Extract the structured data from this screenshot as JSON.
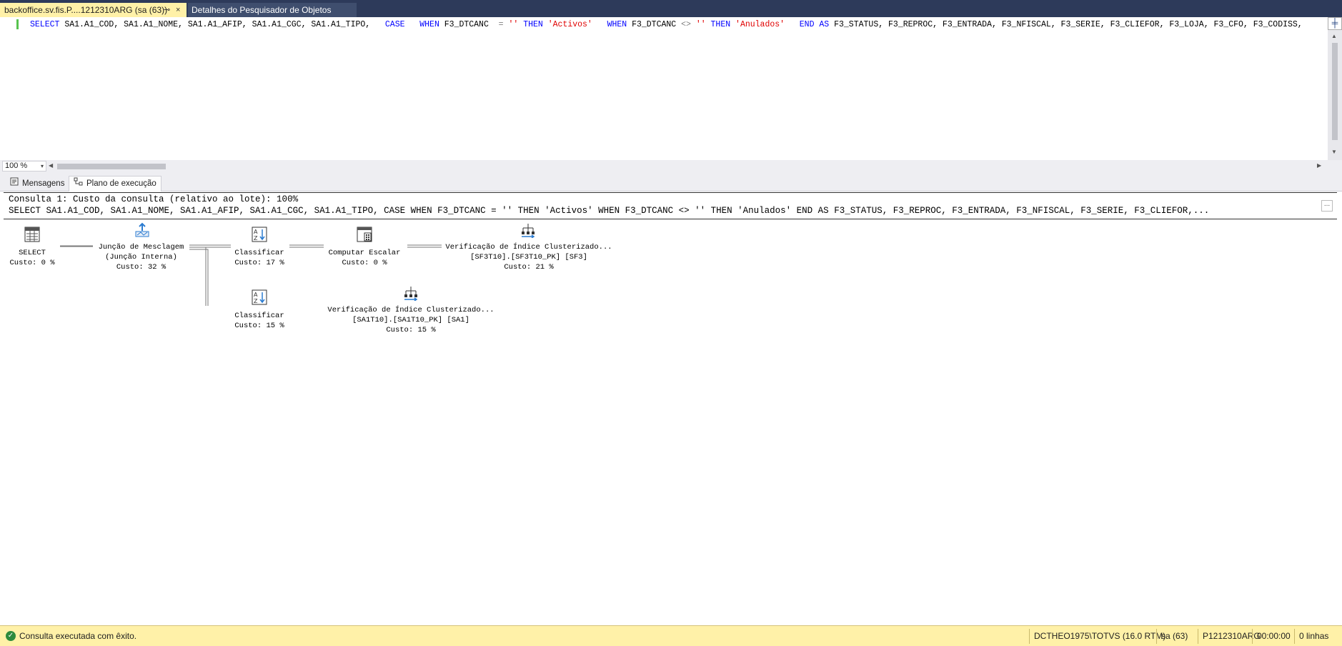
{
  "tabs": {
    "active_label": "backoffice.sv.fis.P....1212310ARG (sa (63))",
    "pin": "⊸",
    "close": "×",
    "inactive_label": "Detalhes do Pesquisador de Objetos"
  },
  "editor": {
    "split_icon": "╪",
    "sql": [
      {
        "t": "SELECT",
        "c": "kw"
      },
      {
        "t": " SA1.A1_COD, SA1.A1_NOME, SA1.A1_AFIP, SA1.A1_CGC, SA1.A1_TIPO,  ",
        "c": ""
      },
      {
        "t": " CASE",
        "c": "kw"
      },
      {
        "t": "   ",
        "c": ""
      },
      {
        "t": "WHEN",
        "c": "kw"
      },
      {
        "t": " F3_DTCANC  ",
        "c": ""
      },
      {
        "t": "=",
        "c": "op"
      },
      {
        "t": " ",
        "c": ""
      },
      {
        "t": "''",
        "c": "str"
      },
      {
        "t": " ",
        "c": ""
      },
      {
        "t": "THEN",
        "c": "kw"
      },
      {
        "t": " ",
        "c": ""
      },
      {
        "t": "'Activos'",
        "c": "str"
      },
      {
        "t": "   ",
        "c": ""
      },
      {
        "t": "WHEN",
        "c": "kw"
      },
      {
        "t": " F3_DTCANC ",
        "c": ""
      },
      {
        "t": "<>",
        "c": "op"
      },
      {
        "t": " ",
        "c": ""
      },
      {
        "t": "''",
        "c": "str"
      },
      {
        "t": " ",
        "c": ""
      },
      {
        "t": "THEN",
        "c": "kw"
      },
      {
        "t": " ",
        "c": ""
      },
      {
        "t": "'Anulados'",
        "c": "str"
      },
      {
        "t": "   ",
        "c": ""
      },
      {
        "t": "END AS",
        "c": "kw"
      },
      {
        "t": " F3_STATUS, F3_REPROC, F3_ENTRADA, F3_NFISCAL, F3_SERIE, F3_CLIEFOR, F3_LOJA, F3_CFO, F3_CODISS,",
        "c": ""
      }
    ]
  },
  "zoom": {
    "value": "100 %",
    "caret": "▾"
  },
  "scroll": {
    "left": "◀",
    "right": "▶",
    "up": "▲",
    "down": "▼"
  },
  "result_tabs": {
    "messages": "Mensagens",
    "plan": "Plano de execução"
  },
  "plan": {
    "header": "Consulta 1: Custo da consulta (relativo ao lote): 100%",
    "sql": "SELECT SA1.A1_COD, SA1.A1_NOME, SA1.A1_AFIP, SA1.A1_CGC, SA1.A1_TIPO, CASE WHEN F3_DTCANC = '' THEN 'Activos' WHEN F3_DTCANC <> '' THEN 'Anulados' END AS F3_STATUS, F3_REPROC, F3_ENTRADA, F3_NFISCAL, F3_SERIE, F3_CLIEFOR,...",
    "more": "...",
    "nodes": {
      "select": {
        "l1": "SELECT",
        "l2": "Custo: 0 %"
      },
      "merge": {
        "l1": "Junção de Mesclagem",
        "l2": "(Junção Interna)",
        "l3": "Custo: 32 %"
      },
      "sort1": {
        "l1": "Classificar",
        "l2": "Custo: 17 %"
      },
      "scalar": {
        "l1": "Computar Escalar",
        "l2": "Custo: 0 %"
      },
      "scan1": {
        "l1": "Verificação de Índice Clusterizado...",
        "l2": "[SF3T10].[SF3T10_PK] [SF3]",
        "l3": "Custo: 21 %"
      },
      "sort2": {
        "l1": "Classificar",
        "l2": "Custo: 15 %"
      },
      "scan2": {
        "l1": "Verificação de Índice Clusterizado...",
        "l2": "[SA1T10].[SA1T10_PK] [SA1]",
        "l3": "Custo: 15 %"
      }
    }
  },
  "status": {
    "check": "✓",
    "message": "Consulta executada com êxito.",
    "server": "DCTHEO1975\\TOTVS (16.0 RTM)",
    "user": "sa (63)",
    "database": "P1212310ARG",
    "time": "00:00:00",
    "rows": "0 linhas"
  }
}
